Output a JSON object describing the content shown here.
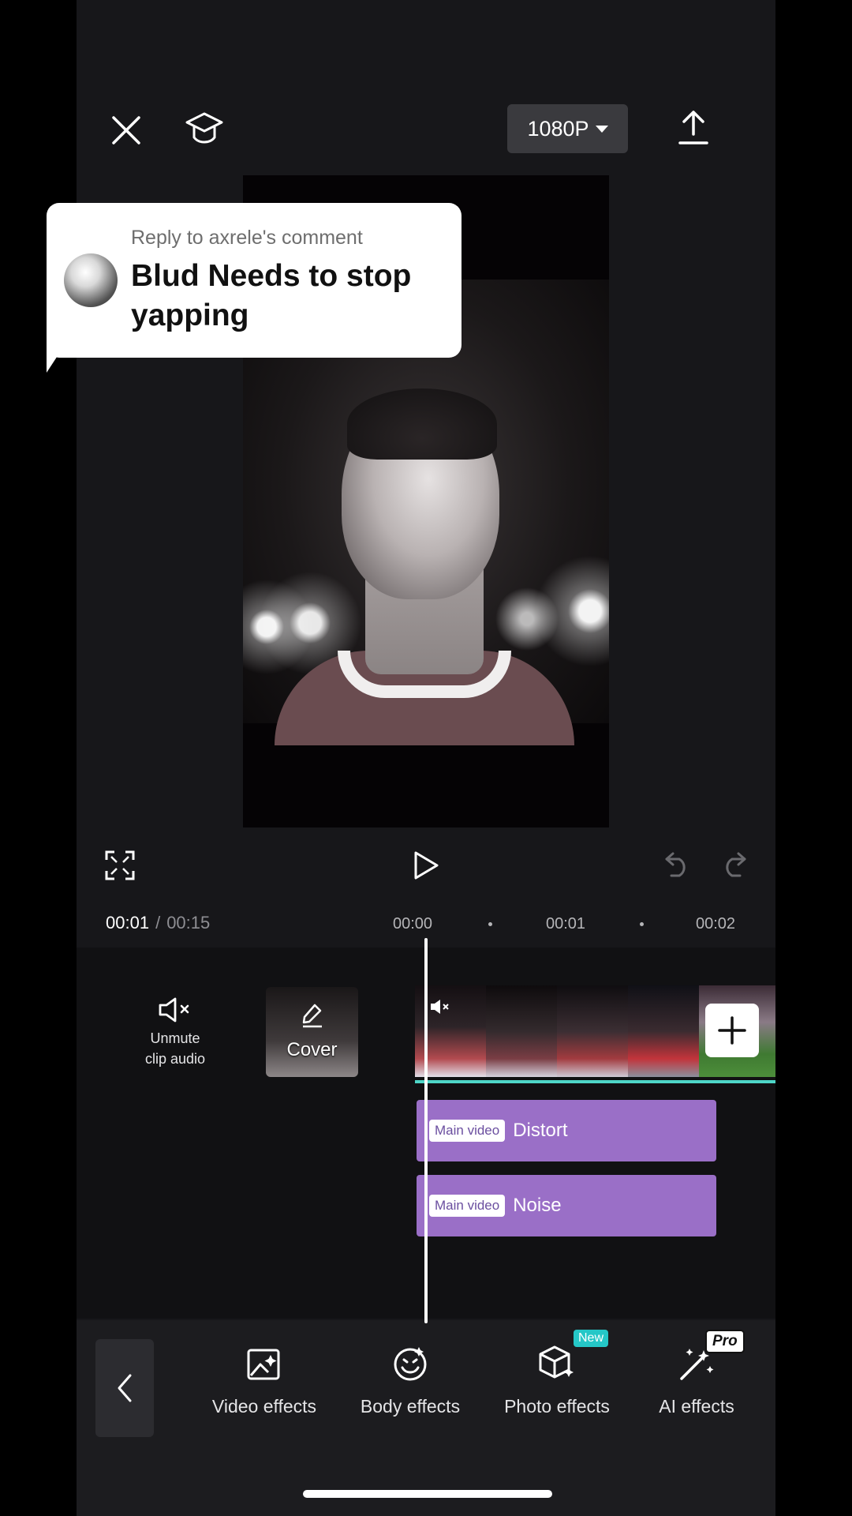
{
  "top_bar": {
    "resolution": "1080P",
    "close_icon": "close-icon",
    "tutorial_icon": "graduation-cap-icon",
    "export_icon": "upload-icon"
  },
  "comment_reply": {
    "reply_to": "Reply to axrele's comment",
    "text": "Blud Needs to stop yapping"
  },
  "playback": {
    "current_time": "00:01",
    "separator": "/",
    "total_time": "00:15"
  },
  "ruler": {
    "labels": [
      "00:00",
      "00:01",
      "00:02"
    ]
  },
  "timeline": {
    "unmute_label_line1": "Unmute",
    "unmute_label_line2": "clip audio",
    "cover_label": "Cover",
    "tracks": [
      {
        "tag": "Main video",
        "label": "Distort"
      },
      {
        "tag": "Main video",
        "label": "Noise"
      }
    ]
  },
  "toolbar": {
    "items": [
      {
        "label": "Video effects",
        "icon": "video-effects-icon"
      },
      {
        "label": "Body effects",
        "icon": "body-effects-icon"
      },
      {
        "label": "Photo effects",
        "icon": "photo-effects-icon",
        "badge": "New"
      },
      {
        "label": "AI effects",
        "icon": "ai-effects-icon",
        "badge": "Pro"
      }
    ]
  },
  "colors": {
    "track": "#9a6fc7",
    "timeline_accent": "#4ed6c8",
    "new_badge": "#25c7c7"
  }
}
